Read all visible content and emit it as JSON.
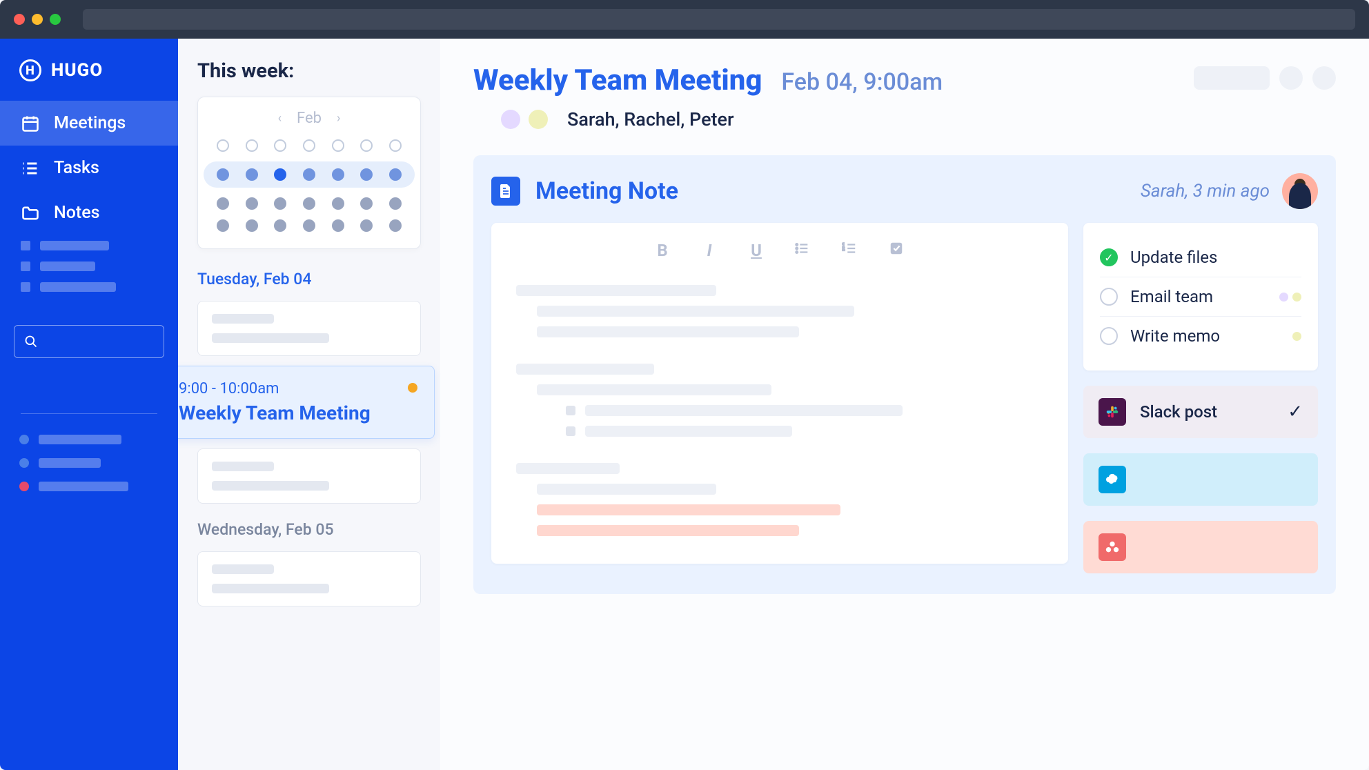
{
  "brand": {
    "name": "HUGO"
  },
  "sidebar": {
    "items": [
      {
        "label": "Meetings",
        "active": true
      },
      {
        "label": "Tasks",
        "active": false
      },
      {
        "label": "Notes",
        "active": false
      }
    ]
  },
  "week": {
    "heading": "This week:",
    "month": "Feb",
    "days": [
      {
        "label": "Tuesday, Feb 04"
      },
      {
        "label": "Wednesday, Feb 05"
      }
    ],
    "selected_event": {
      "time": "9:00 - 10:00am",
      "title": "Weekly Team Meeting"
    }
  },
  "meeting": {
    "title": "Weekly Team Meeting",
    "datetime": "Feb 04, 9:00am",
    "attendees": "Sarah, Rachel, Peter",
    "attendee_colors": [
      "#fecfc7",
      "#e4d9ff",
      "#eff0b8"
    ]
  },
  "note": {
    "heading": "Meeting Note",
    "meta_author": "Sarah",
    "meta_time": "3 min ago",
    "meta": "Sarah, 3 min ago",
    "tasks": [
      {
        "label": "Update files",
        "done": true,
        "dots": []
      },
      {
        "label": "Email team",
        "done": false,
        "dots": [
          "#e4d9ff",
          "#eff0b8"
        ]
      },
      {
        "label": "Write memo",
        "done": false,
        "dots": [
          "#eff0b8"
        ]
      }
    ],
    "integrations": {
      "slack": {
        "label": "Slack post",
        "bg": "#f0ecf3",
        "icon_bg": "#4a154b",
        "checked": true
      },
      "salesforce": {
        "label": "",
        "bg": "#d0eefb",
        "icon_bg": "#00a1e0"
      },
      "asana": {
        "label": "",
        "bg": "#ffdbd4",
        "icon_bg": "#f06a6a"
      }
    }
  }
}
